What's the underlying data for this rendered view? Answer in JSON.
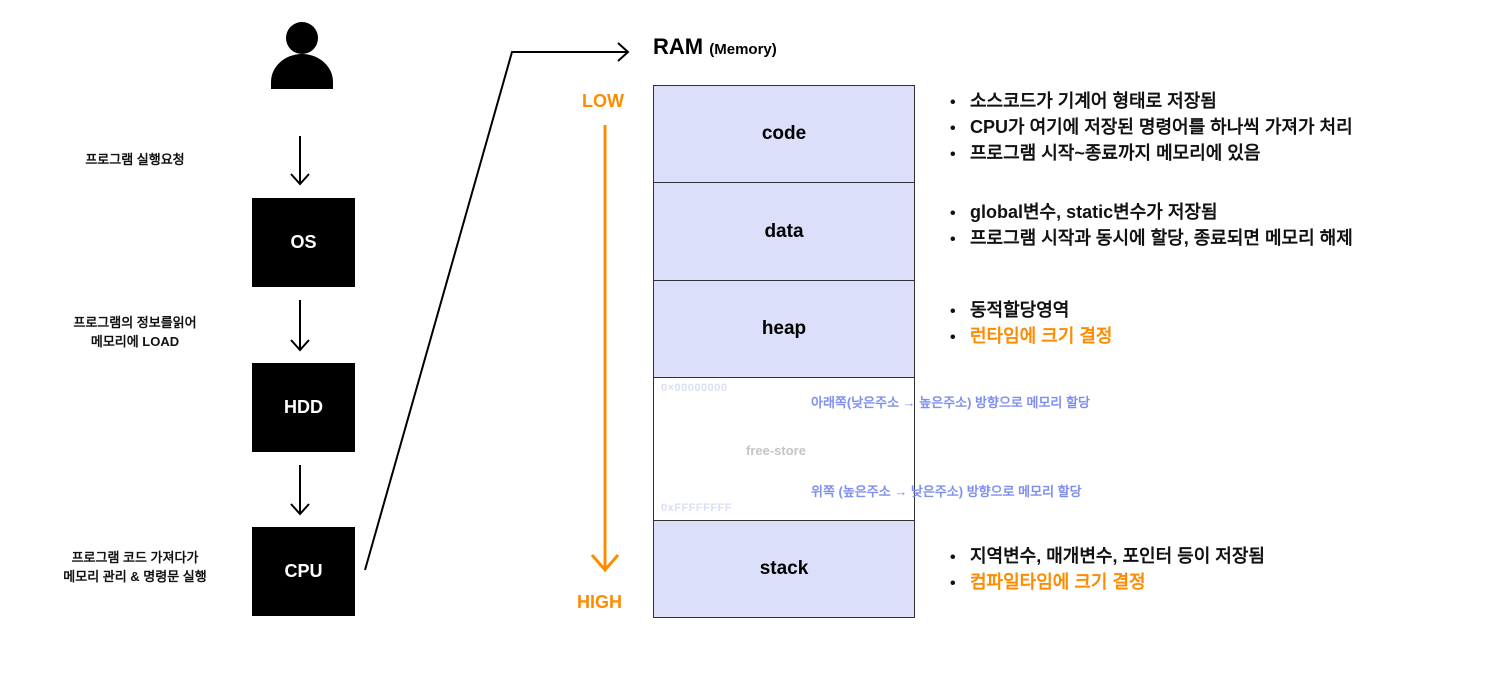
{
  "flow": {
    "steps": [
      {
        "label_lines": [
          "프로그램 실행요청"
        ]
      },
      {
        "label_lines": [
          "프로그램의 정보를읽어",
          "메모리에 LOAD"
        ]
      },
      {
        "label_lines": [
          "프로그램 코드 가져다가",
          "메모리 관리 & 명령문 실행"
        ]
      }
    ],
    "boxes": [
      "OS",
      "HDD",
      "CPU"
    ],
    "user_icon": "person-icon"
  },
  "ram": {
    "title": "RAM",
    "subtitle": "(Memory)",
    "low_label": "LOW",
    "high_label": "HIGH",
    "accent_color": "#ff8c00",
    "segments": [
      {
        "name": "code",
        "notes": [
          {
            "text": "소스코드가 기계어 형태로 저장됨",
            "highlight": false
          },
          {
            "text": "CPU가 여기에 저장된 명령어를 하나씩 가져가 처리",
            "highlight": false
          },
          {
            "text": "프로그램 시작~종료까지 메모리에 있음",
            "highlight": false
          }
        ]
      },
      {
        "name": "data",
        "notes": [
          {
            "text": "global변수, static변수가 저장됨",
            "highlight": false
          },
          {
            "text": "프로그램 시작과 동시에 할당, 종료되면 메모리 해제",
            "highlight": false
          }
        ]
      },
      {
        "name": "heap",
        "notes": [
          {
            "text": "동적할당영역",
            "highlight": false
          },
          {
            "text": "런타임에 크기 결정",
            "highlight": true
          }
        ]
      },
      {
        "name": "stack",
        "notes": [
          {
            "text": "지역변수, 매개변수, 포인터 등이 저장됨",
            "highlight": false
          },
          {
            "text": "컴파일타임에 크기 결정",
            "highlight": true
          }
        ]
      }
    ],
    "free_store": {
      "name": "free-store",
      "addr_low": "0×00000000",
      "addr_high": "0xFFFFFFFF",
      "heap_direction": "아래쪽(낮은주소 → 높은주소) 방향으로 메모리 할당",
      "stack_direction": "위쪽 (높은주소 → 낮은주소) 방향으로 메모리 할당"
    }
  }
}
